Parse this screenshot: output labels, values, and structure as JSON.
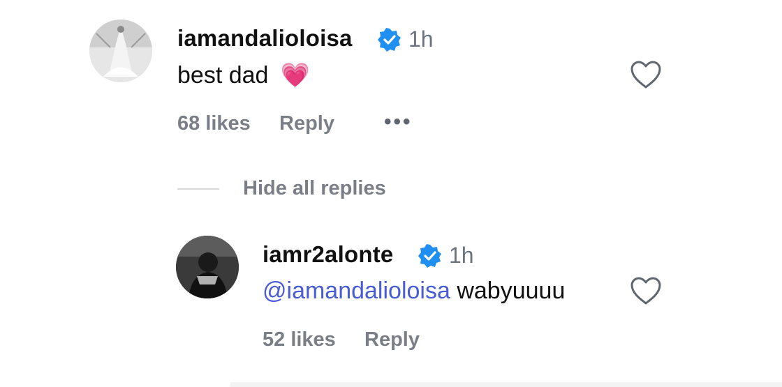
{
  "comment": {
    "username": "iamandalioloisa",
    "time": "1h",
    "text": "best dad",
    "emoji": "💗",
    "likes": "68 likes",
    "reply_label": "Reply",
    "more_label": "•••"
  },
  "replies_toggle": {
    "label": "Hide all replies"
  },
  "reply": {
    "username": "iamr2alonte",
    "time": "1h",
    "mention": "@iamandalioloisa",
    "text": "wabyuuuu",
    "likes": "52 likes",
    "reply_label": "Reply"
  },
  "colors": {
    "verified_blue": "#1f8ff2",
    "mention_blue": "#4a5bd6",
    "meta_gray": "#7a7f87",
    "heart_pink": "#f05aa8"
  },
  "icons": {
    "verified": "verified-badge-icon",
    "like": "heart-outline-icon",
    "more": "more-options-icon"
  }
}
